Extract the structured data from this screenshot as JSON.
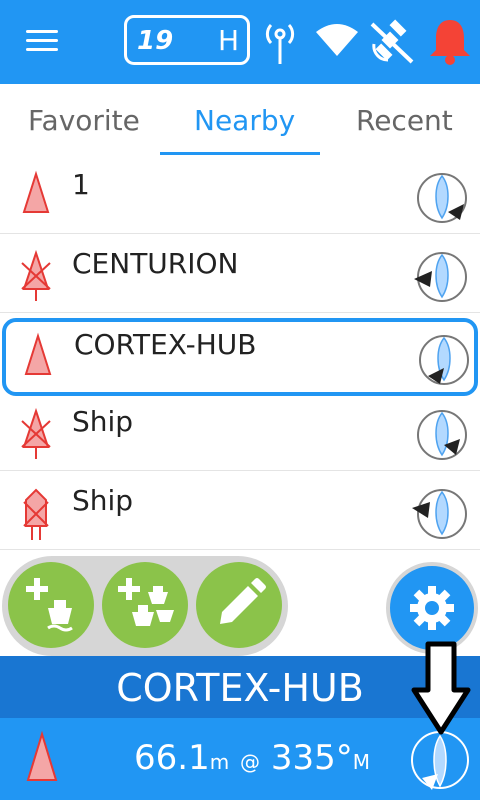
{
  "header": {
    "speed_value": "19",
    "speed_unit": "H"
  },
  "tabs": [
    {
      "label": "Favorite"
    },
    {
      "label": "Nearby"
    },
    {
      "label": "Recent"
    }
  ],
  "list": {
    "items": [
      {
        "name": "1"
      },
      {
        "name": "CENTURION"
      },
      {
        "name": "CORTEX-HUB"
      },
      {
        "name": "Ship"
      },
      {
        "name": "Ship"
      }
    ]
  },
  "status": {
    "selected_name": "CORTEX-HUB",
    "distance": "66.1",
    "distance_unit": "m",
    "at": "@",
    "bearing": "335°",
    "bearing_ref": "M"
  },
  "colors": {
    "primary": "#2196F3",
    "dark_primary": "#1976D2",
    "green": "#8BC34A",
    "alarm": "#F44336",
    "marker_fill": "#F4A6A6",
    "marker_stroke": "#E53935"
  }
}
